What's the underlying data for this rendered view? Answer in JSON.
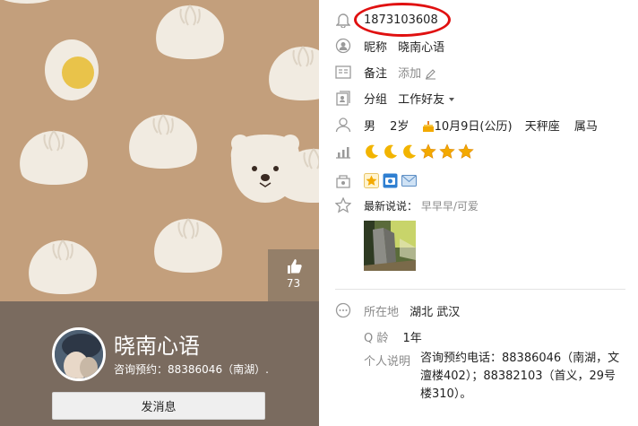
{
  "profile": {
    "qq_number": "1873103608",
    "nickname_label": "昵称",
    "nickname": "晓南心语",
    "note_label": "备注",
    "note_action": "添加",
    "group_label": "分组",
    "group_value": "工作好友",
    "gender": "男",
    "age": "2岁",
    "birthday": "10月9日(公历)",
    "zodiac": "天秤座",
    "chinese_zodiac": "属马",
    "level_icons": [
      "moon",
      "moon",
      "moon",
      "star",
      "star",
      "star"
    ],
    "status_icons": [
      "star-badge-icon",
      "camera-icon",
      "mail-icon"
    ],
    "latest_post_label": "最新说说：",
    "latest_post": "早早早/可爱",
    "location_label": "所在地",
    "location_value": "湖北 武汉",
    "qage_label": "Q 龄",
    "qage_value": "1年",
    "bio_label": "个人说明",
    "bio_value": "咨询预约电话：88386046（南湖，文澶楼402）；88382103（首义，29号楼310）。"
  },
  "cover": {
    "like_count": "73",
    "display_name": "晓南心语",
    "subtitle": "咨询预约：88386046（南湖）.",
    "message_button": "发消息"
  },
  "colors": {
    "cover_bg": "#c39f7c",
    "card_bg": "#7a6b5f",
    "highlight_oval": "#e01010",
    "bun": "#f1ebe1",
    "moon": "#f2b400",
    "star": "#f3a900"
  }
}
